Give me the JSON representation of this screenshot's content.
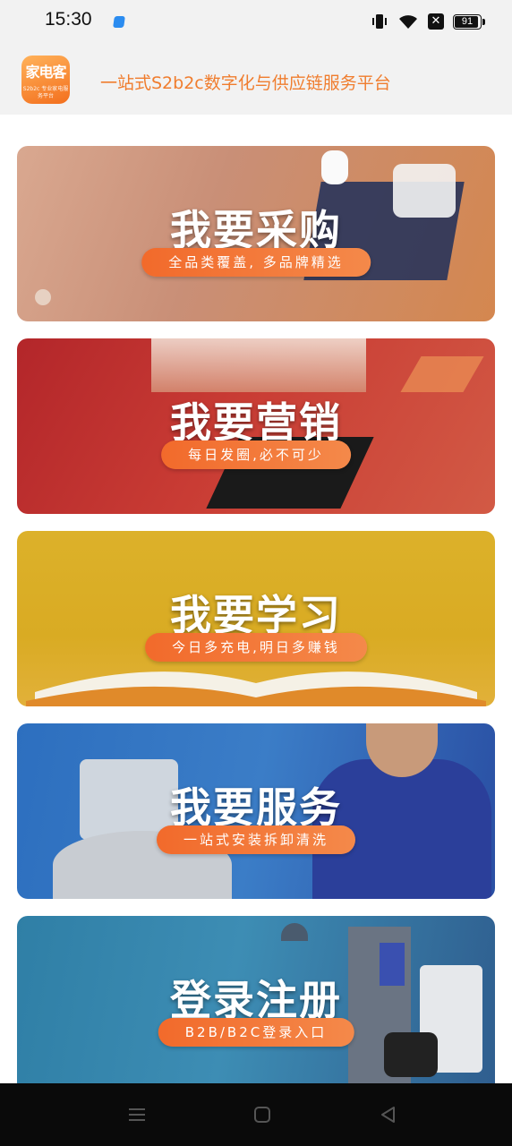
{
  "status_bar": {
    "time": "15:30",
    "battery_level": "91",
    "icons": [
      "app-notification-icon",
      "vibrate-icon",
      "wifi-icon",
      "sim-x-icon",
      "battery-icon"
    ]
  },
  "header": {
    "logo_text": "家电客",
    "logo_sub_text": "S2b2c 专业家电服务平台",
    "slogan": "一站式S2b2c数字化与供应链服务平台"
  },
  "banners": [
    {
      "title": "我要采购",
      "subtitle": "全品类覆盖, 多品牌精选"
    },
    {
      "title": "我要营销",
      "subtitle": "每日发圈,必不可少"
    },
    {
      "title": "我要学习",
      "subtitle": "今日多充电,明日多赚钱"
    },
    {
      "title": "我要服务",
      "subtitle": "一站式安装拆卸清洗"
    },
    {
      "title": "登录注册",
      "subtitle": "B2B/B2C登录入口"
    }
  ],
  "nav_bar": {
    "buttons": [
      "menu-icon",
      "home-icon",
      "back-icon"
    ]
  },
  "colors": {
    "accent": "#f07d2e",
    "pill": "#f26a2b",
    "header_bg": "#f2f2f2"
  }
}
